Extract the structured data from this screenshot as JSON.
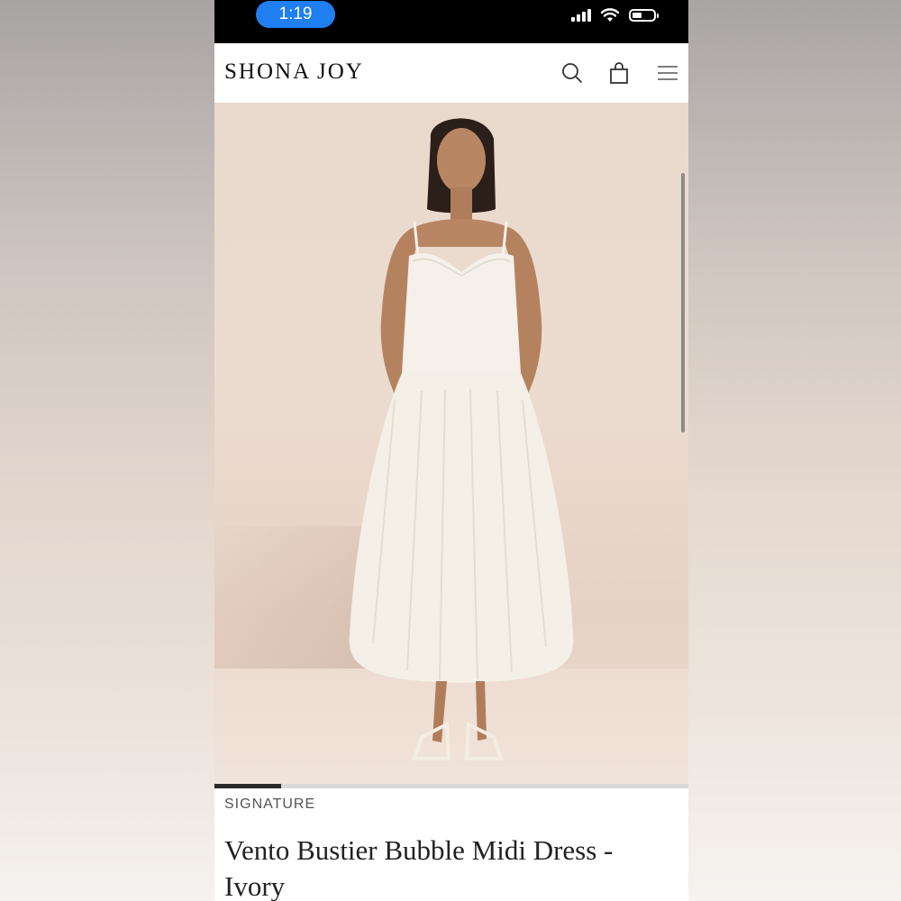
{
  "status_bar": {
    "time": "1:19",
    "time_pill_color": "#1f7ef0",
    "icons": [
      "signal-icon",
      "wifi-icon",
      "battery-icon"
    ]
  },
  "header": {
    "logo": "SHONA JOY",
    "icons": [
      "search-icon",
      "shopping-bag-icon",
      "menu-icon"
    ]
  },
  "gallery": {
    "image_alt_name": "product-photo",
    "progress": 0.14
  },
  "product": {
    "category": "SIGNATURE",
    "title": "Vento Bustier Bubble Midi Dress - Ivory"
  }
}
